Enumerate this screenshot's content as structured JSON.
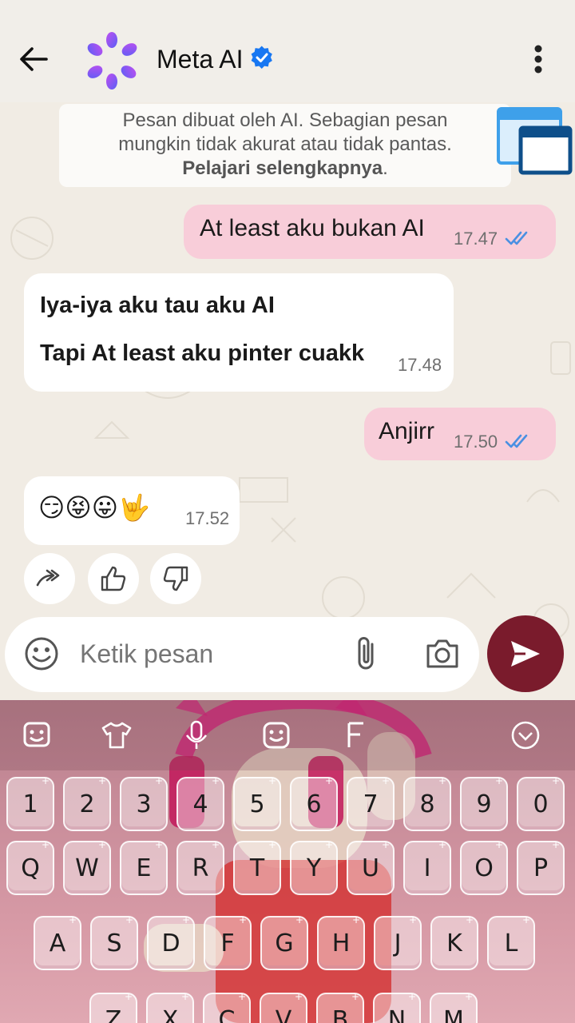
{
  "header": {
    "title": "Meta AI",
    "verified": true
  },
  "notice": {
    "line1": "Pesan dibuat oleh AI. Sebagian pesan",
    "line2": "mungkin tidak akurat atau tidak pantas.",
    "link": "Pelajari selengkapnya",
    "period": "."
  },
  "messages": [
    {
      "direction": "out",
      "text": "At least aku bukan AI",
      "time": "17.47",
      "status": "read"
    },
    {
      "direction": "in",
      "line1": "Iya-iya aku tau aku AI",
      "line2": "Tapi At least aku pinter cuakk",
      "time": "17.48"
    },
    {
      "direction": "out",
      "text": "Anjirr",
      "time": "17.50",
      "status": "read"
    },
    {
      "direction": "in",
      "text": "😏😝😛🤟",
      "time": "17.52"
    }
  ],
  "reactions": [
    "forward-icon",
    "thumbs-up-icon",
    "thumbs-down-icon"
  ],
  "composer": {
    "placeholder": "Ketik pesan"
  },
  "keyboard": {
    "toolbar": [
      "sticker-icon",
      "theme-shirt-icon",
      "microphone-icon",
      "emoji-icon",
      "font-icon",
      "collapse-icon"
    ],
    "row_numbers": [
      "1",
      "2",
      "3",
      "4",
      "5",
      "6",
      "7",
      "8",
      "9",
      "0"
    ],
    "row_top": [
      "Q",
      "W",
      "E",
      "R",
      "T",
      "Y",
      "U",
      "I",
      "O",
      "P"
    ],
    "row_middle": [
      "A",
      "S",
      "D",
      "F",
      "G",
      "H",
      "J",
      "K",
      "L"
    ],
    "row_bottom": [
      "Z",
      "X",
      "C",
      "V",
      "B",
      "N",
      "M"
    ]
  },
  "colors": {
    "accent_send": "#7a1b2c",
    "outgoing_bubble": "#f8cdd9",
    "read_ticks": "#4a90e2",
    "verified_badge": "#1877f2"
  }
}
